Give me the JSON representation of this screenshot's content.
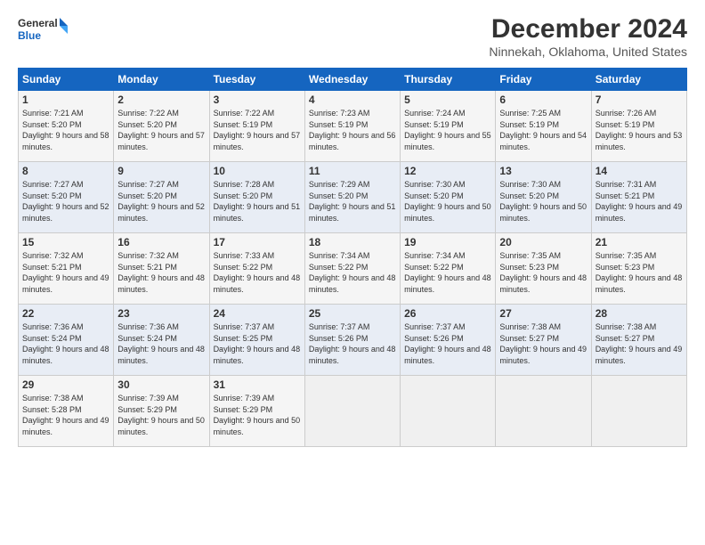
{
  "header": {
    "logo_line1": "General",
    "logo_line2": "Blue",
    "title": "December 2024",
    "subtitle": "Ninnekah, Oklahoma, United States"
  },
  "days_of_week": [
    "Sunday",
    "Monday",
    "Tuesday",
    "Wednesday",
    "Thursday",
    "Friday",
    "Saturday"
  ],
  "weeks": [
    [
      {
        "day": "1",
        "sunrise": "Sunrise: 7:21 AM",
        "sunset": "Sunset: 5:20 PM",
        "daylight": "Daylight: 9 hours and 58 minutes."
      },
      {
        "day": "2",
        "sunrise": "Sunrise: 7:22 AM",
        "sunset": "Sunset: 5:20 PM",
        "daylight": "Daylight: 9 hours and 57 minutes."
      },
      {
        "day": "3",
        "sunrise": "Sunrise: 7:22 AM",
        "sunset": "Sunset: 5:19 PM",
        "daylight": "Daylight: 9 hours and 57 minutes."
      },
      {
        "day": "4",
        "sunrise": "Sunrise: 7:23 AM",
        "sunset": "Sunset: 5:19 PM",
        "daylight": "Daylight: 9 hours and 56 minutes."
      },
      {
        "day": "5",
        "sunrise": "Sunrise: 7:24 AM",
        "sunset": "Sunset: 5:19 PM",
        "daylight": "Daylight: 9 hours and 55 minutes."
      },
      {
        "day": "6",
        "sunrise": "Sunrise: 7:25 AM",
        "sunset": "Sunset: 5:19 PM",
        "daylight": "Daylight: 9 hours and 54 minutes."
      },
      {
        "day": "7",
        "sunrise": "Sunrise: 7:26 AM",
        "sunset": "Sunset: 5:19 PM",
        "daylight": "Daylight: 9 hours and 53 minutes."
      }
    ],
    [
      {
        "day": "8",
        "sunrise": "Sunrise: 7:27 AM",
        "sunset": "Sunset: 5:20 PM",
        "daylight": "Daylight: 9 hours and 52 minutes."
      },
      {
        "day": "9",
        "sunrise": "Sunrise: 7:27 AM",
        "sunset": "Sunset: 5:20 PM",
        "daylight": "Daylight: 9 hours and 52 minutes."
      },
      {
        "day": "10",
        "sunrise": "Sunrise: 7:28 AM",
        "sunset": "Sunset: 5:20 PM",
        "daylight": "Daylight: 9 hours and 51 minutes."
      },
      {
        "day": "11",
        "sunrise": "Sunrise: 7:29 AM",
        "sunset": "Sunset: 5:20 PM",
        "daylight": "Daylight: 9 hours and 51 minutes."
      },
      {
        "day": "12",
        "sunrise": "Sunrise: 7:30 AM",
        "sunset": "Sunset: 5:20 PM",
        "daylight": "Daylight: 9 hours and 50 minutes."
      },
      {
        "day": "13",
        "sunrise": "Sunrise: 7:30 AM",
        "sunset": "Sunset: 5:20 PM",
        "daylight": "Daylight: 9 hours and 50 minutes."
      },
      {
        "day": "14",
        "sunrise": "Sunrise: 7:31 AM",
        "sunset": "Sunset: 5:21 PM",
        "daylight": "Daylight: 9 hours and 49 minutes."
      }
    ],
    [
      {
        "day": "15",
        "sunrise": "Sunrise: 7:32 AM",
        "sunset": "Sunset: 5:21 PM",
        "daylight": "Daylight: 9 hours and 49 minutes."
      },
      {
        "day": "16",
        "sunrise": "Sunrise: 7:32 AM",
        "sunset": "Sunset: 5:21 PM",
        "daylight": "Daylight: 9 hours and 48 minutes."
      },
      {
        "day": "17",
        "sunrise": "Sunrise: 7:33 AM",
        "sunset": "Sunset: 5:22 PM",
        "daylight": "Daylight: 9 hours and 48 minutes."
      },
      {
        "day": "18",
        "sunrise": "Sunrise: 7:34 AM",
        "sunset": "Sunset: 5:22 PM",
        "daylight": "Daylight: 9 hours and 48 minutes."
      },
      {
        "day": "19",
        "sunrise": "Sunrise: 7:34 AM",
        "sunset": "Sunset: 5:22 PM",
        "daylight": "Daylight: 9 hours and 48 minutes."
      },
      {
        "day": "20",
        "sunrise": "Sunrise: 7:35 AM",
        "sunset": "Sunset: 5:23 PM",
        "daylight": "Daylight: 9 hours and 48 minutes."
      },
      {
        "day": "21",
        "sunrise": "Sunrise: 7:35 AM",
        "sunset": "Sunset: 5:23 PM",
        "daylight": "Daylight: 9 hours and 48 minutes."
      }
    ],
    [
      {
        "day": "22",
        "sunrise": "Sunrise: 7:36 AM",
        "sunset": "Sunset: 5:24 PM",
        "daylight": "Daylight: 9 hours and 48 minutes."
      },
      {
        "day": "23",
        "sunrise": "Sunrise: 7:36 AM",
        "sunset": "Sunset: 5:24 PM",
        "daylight": "Daylight: 9 hours and 48 minutes."
      },
      {
        "day": "24",
        "sunrise": "Sunrise: 7:37 AM",
        "sunset": "Sunset: 5:25 PM",
        "daylight": "Daylight: 9 hours and 48 minutes."
      },
      {
        "day": "25",
        "sunrise": "Sunrise: 7:37 AM",
        "sunset": "Sunset: 5:26 PM",
        "daylight": "Daylight: 9 hours and 48 minutes."
      },
      {
        "day": "26",
        "sunrise": "Sunrise: 7:37 AM",
        "sunset": "Sunset: 5:26 PM",
        "daylight": "Daylight: 9 hours and 48 minutes."
      },
      {
        "day": "27",
        "sunrise": "Sunrise: 7:38 AM",
        "sunset": "Sunset: 5:27 PM",
        "daylight": "Daylight: 9 hours and 49 minutes."
      },
      {
        "day": "28",
        "sunrise": "Sunrise: 7:38 AM",
        "sunset": "Sunset: 5:27 PM",
        "daylight": "Daylight: 9 hours and 49 minutes."
      }
    ],
    [
      {
        "day": "29",
        "sunrise": "Sunrise: 7:38 AM",
        "sunset": "Sunset: 5:28 PM",
        "daylight": "Daylight: 9 hours and 49 minutes."
      },
      {
        "day": "30",
        "sunrise": "Sunrise: 7:39 AM",
        "sunset": "Sunset: 5:29 PM",
        "daylight": "Daylight: 9 hours and 50 minutes."
      },
      {
        "day": "31",
        "sunrise": "Sunrise: 7:39 AM",
        "sunset": "Sunset: 5:29 PM",
        "daylight": "Daylight: 9 hours and 50 minutes."
      },
      null,
      null,
      null,
      null
    ]
  ]
}
